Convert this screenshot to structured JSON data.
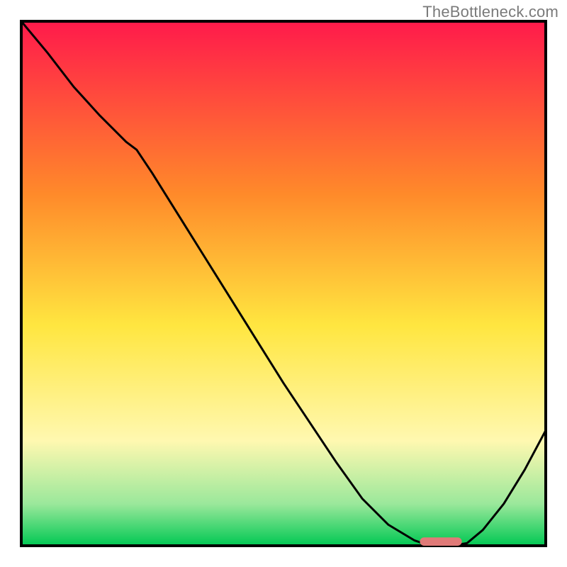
{
  "watermark": "TheBottleneck.com",
  "colors": {
    "frame": "#000000",
    "curve": "#000000",
    "marker_fill": "#e07a78",
    "grad_top": "#ff1a4b",
    "grad_mid_upper": "#ff8a2a",
    "grad_mid": "#ffe640",
    "grad_lower": "#fff8b0",
    "grad_green_light": "#9be89b",
    "grad_green": "#00c853"
  },
  "chart_data": {
    "type": "line",
    "title": "",
    "xlabel": "",
    "ylabel": "",
    "xlim": [
      0,
      100
    ],
    "ylim": [
      0,
      100
    ],
    "grid": false,
    "legend": false,
    "series": [
      {
        "name": "bottleneck-curve",
        "x": [
          0,
          5,
          10,
          15,
          20,
          22,
          25,
          30,
          35,
          40,
          45,
          50,
          55,
          60,
          65,
          70,
          75,
          78,
          80,
          82,
          85,
          88,
          92,
          96,
          100
        ],
        "y": [
          100,
          94,
          87.5,
          82,
          77,
          75.5,
          71,
          63,
          55,
          47,
          39,
          31,
          23.5,
          16,
          9,
          4,
          1,
          0,
          0,
          0,
          0.5,
          3,
          8,
          14.5,
          22
        ]
      }
    ],
    "marker": {
      "name": "optimal-range",
      "x_start": 76,
      "x_end": 84,
      "y": 0,
      "height": 1.6
    }
  }
}
